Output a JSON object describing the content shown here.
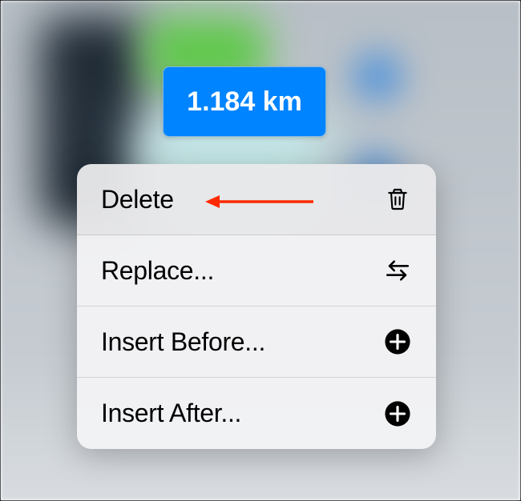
{
  "token": {
    "value": "1.184 km"
  },
  "menu": {
    "items": [
      {
        "label": "Delete",
        "icon": "trash"
      },
      {
        "label": "Replace...",
        "icon": "swap"
      },
      {
        "label": "Insert Before...",
        "icon": "plus"
      },
      {
        "label": "Insert After...",
        "icon": "plus"
      }
    ]
  },
  "annotation": {
    "target": "delete",
    "type": "arrow",
    "color": "#ff2a00"
  }
}
